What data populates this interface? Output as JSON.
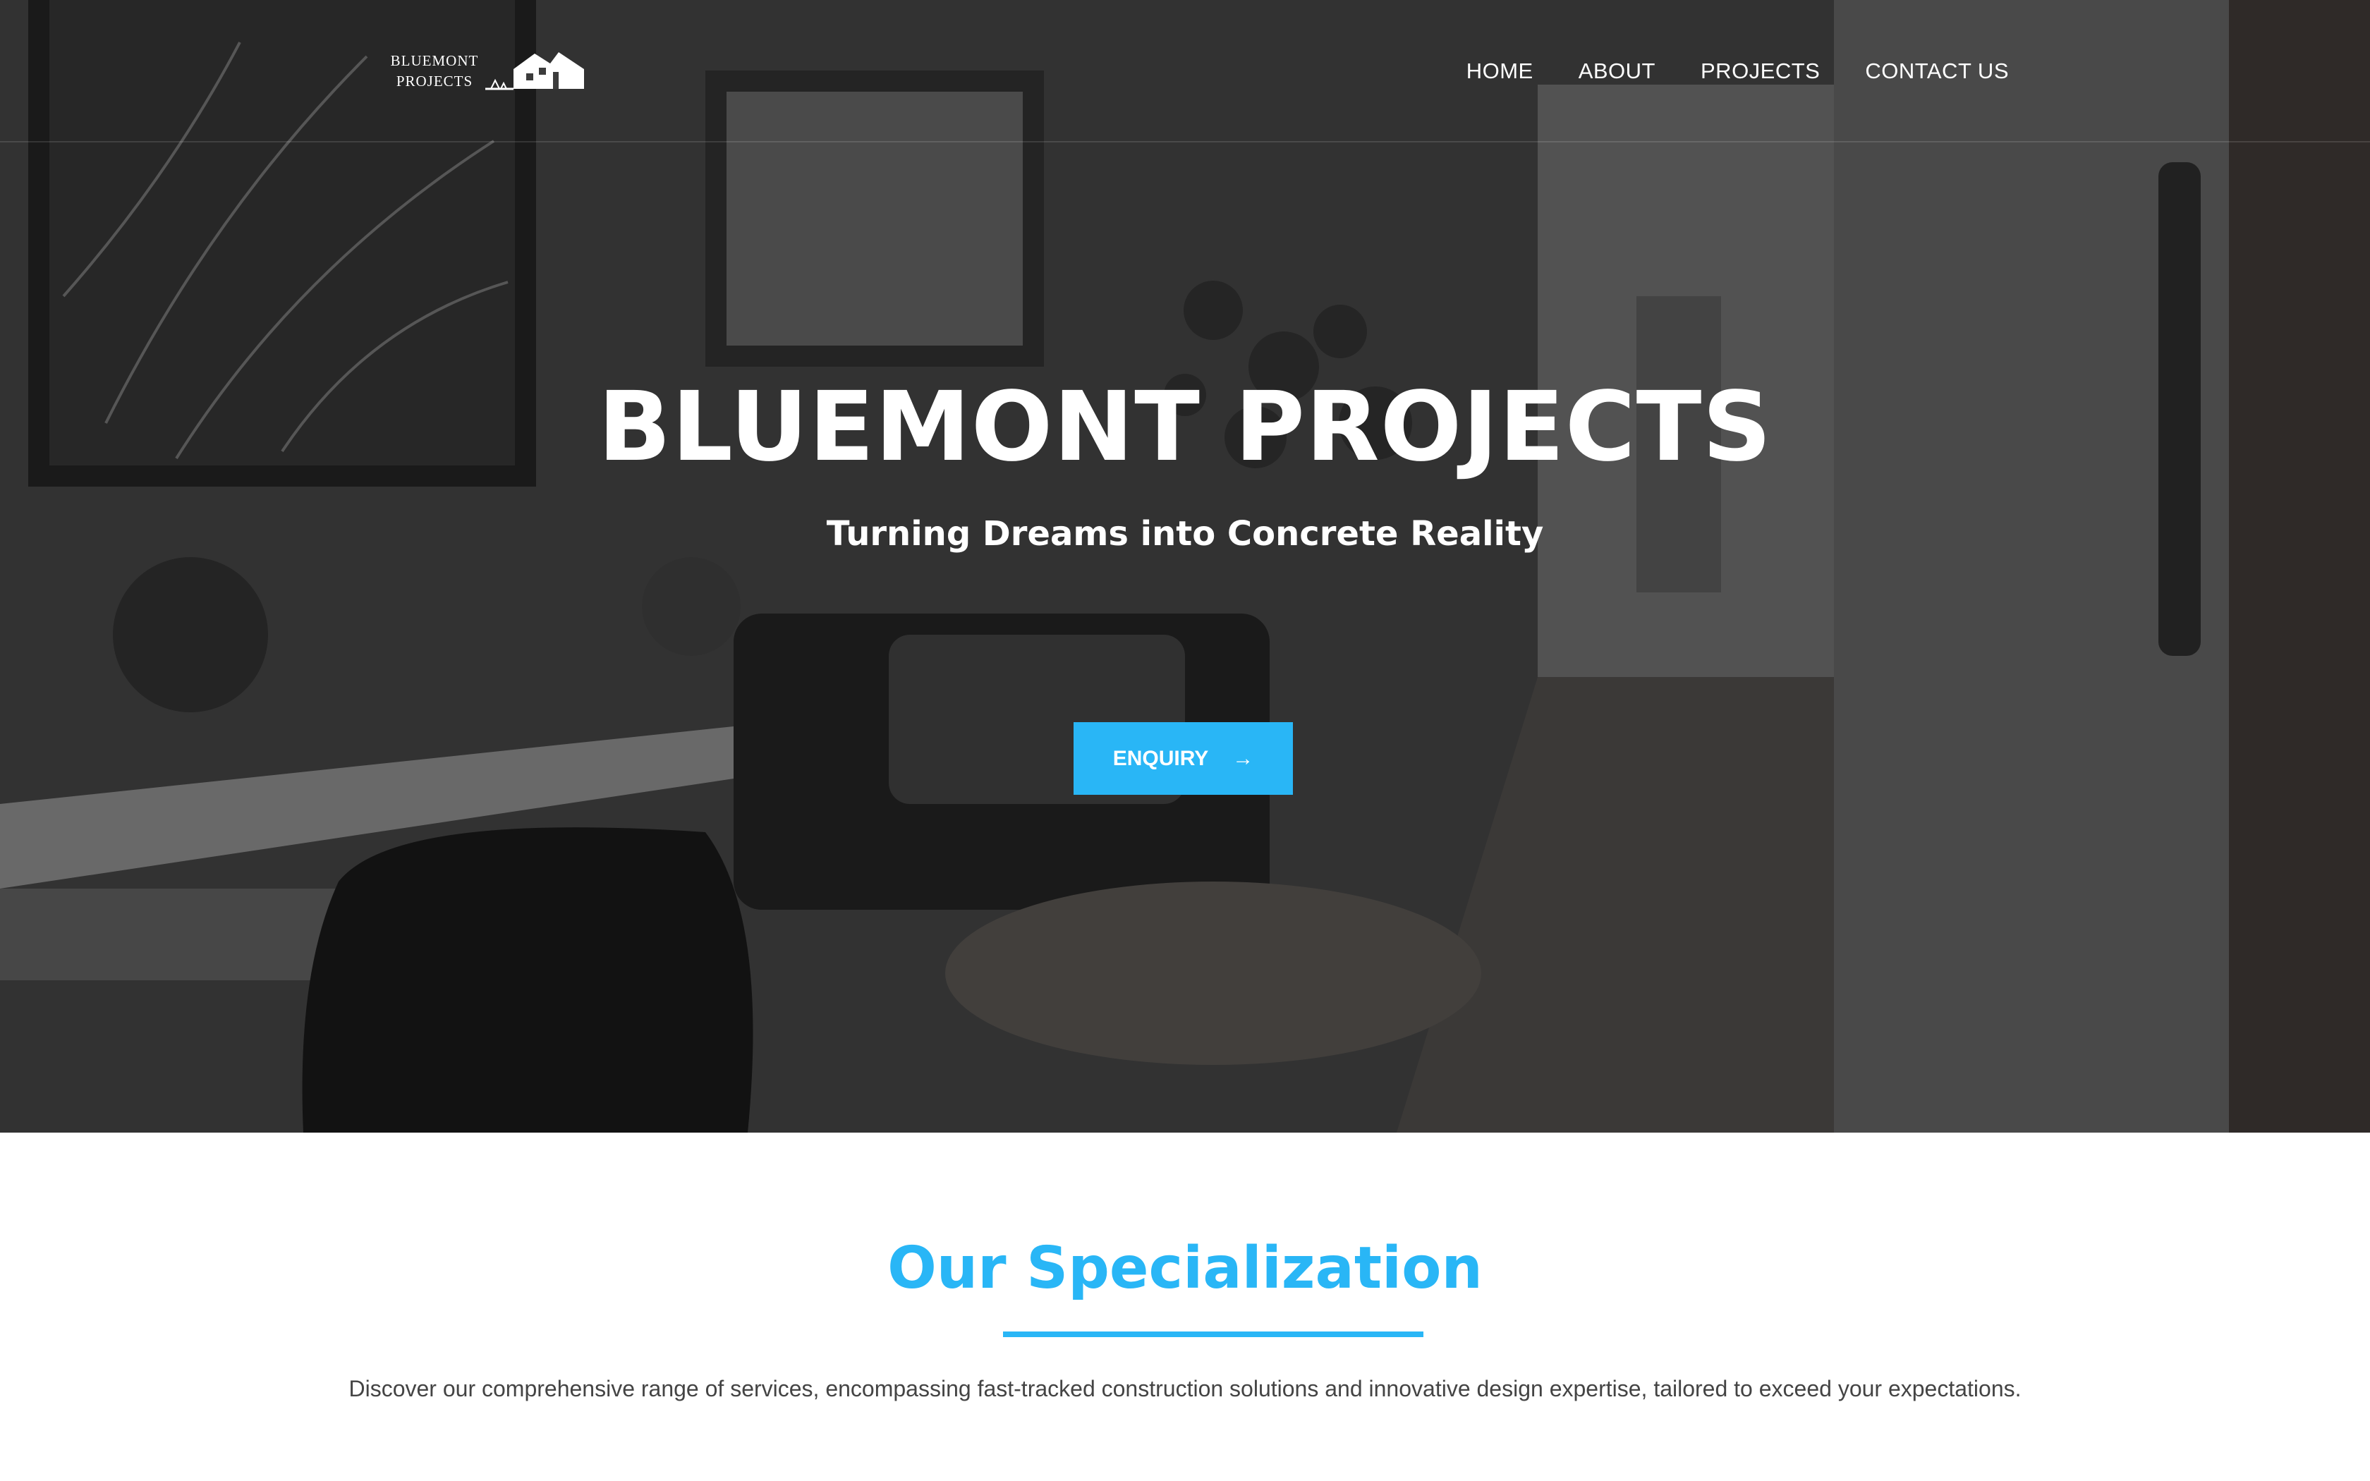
{
  "brand": {
    "logo_line1": "BLUEMONT",
    "logo_line2": "PROJECTS",
    "logo_icon": "house-icon"
  },
  "nav": {
    "items": [
      {
        "label": "HOME"
      },
      {
        "label": "ABOUT"
      },
      {
        "label": "PROJECTS"
      },
      {
        "label": "CONTACT US"
      }
    ]
  },
  "hero": {
    "title": "BLUEMONT PROJECTS",
    "subtitle": "Turning Dreams into Concrete Reality",
    "cta_label": "ENQUIRY",
    "cta_icon": "arrow-right-icon"
  },
  "specialization": {
    "title": "Our Specialization",
    "description": "Discover our comprehensive range of services, encompassing fast-tracked construction solutions and innovative design expertise, tailored to exceed your expectations."
  },
  "colors": {
    "accent": "#29b6f6",
    "text_dark": "#444444",
    "hero_overlay": "#2f2f2f"
  }
}
